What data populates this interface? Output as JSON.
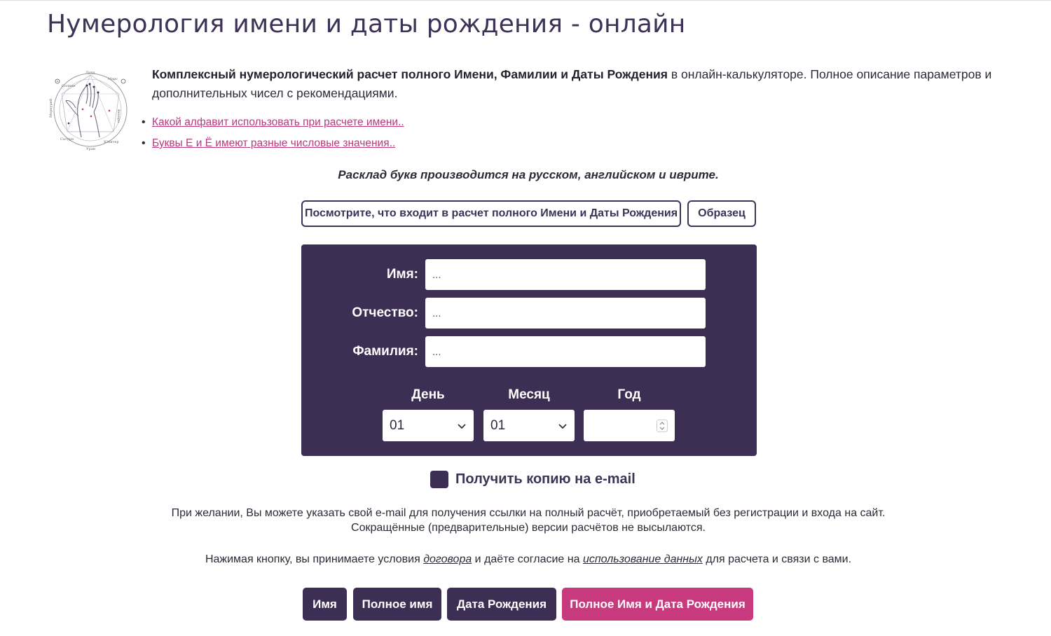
{
  "page": {
    "title": "Нумерология имени и даты рождения - онлайн"
  },
  "intro": {
    "bold": "Комплексный нумерологический расчет полного Имени, Фамилии и Даты Рождения",
    "rest": " в онлайн-калькуляторе. Полное описание параметров и дополнительных чисел с рекомендациями."
  },
  "links": [
    {
      "label": "Какой алфавит использовать при расчете имени.."
    },
    {
      "label": "Буквы Е и Ё имеют разные числовые значения.."
    }
  ],
  "note": "Расклад букв производится на русском, английском и иврите.",
  "top_buttons": {
    "includes": "Посмотрите, что входит в расчет полного Имени и Даты Рождения",
    "sample": "Образец"
  },
  "form": {
    "name_label": "Имя:",
    "name_placeholder": "...",
    "patronymic_label": "Отчество:",
    "patronymic_placeholder": "...",
    "surname_label": "Фамилия:",
    "surname_placeholder": "...",
    "day_label": "День",
    "day_value": "01",
    "month_label": "Месяц",
    "month_value": "01",
    "year_label": "Год",
    "year_value": ""
  },
  "email": {
    "label": "Получить копию на e-mail"
  },
  "hint": {
    "line1": "При желании, Вы можете указать свой e-mail для получения ссылки на полный расчёт, приобретаемый без регистрации и входа на сайт.",
    "line2": "Сокращённые (предварительные) версии расчётов не высылаются."
  },
  "consent": {
    "pre": "Нажимая кнопку, вы принимаете условия ",
    "contract_link": "договора",
    "mid": " и даёте согласие на ",
    "data_link": "использование данных",
    "post": " для расчета и связи с вами."
  },
  "actions": {
    "name": "Имя",
    "full_name": "Полное имя",
    "birth_date": "Дата Рождения",
    "full_name_and_date": "Полное Имя и Дата Рождения"
  },
  "colors": {
    "primary": "#3d2e54",
    "accent": "#c73a7e",
    "link": "#b73a7c"
  },
  "logo": {
    "lettering": [
      "Луна",
      "Марс",
      "Солнце",
      "Меркурий",
      "Венера",
      "Сатурн",
      "Юпитер"
    ]
  }
}
